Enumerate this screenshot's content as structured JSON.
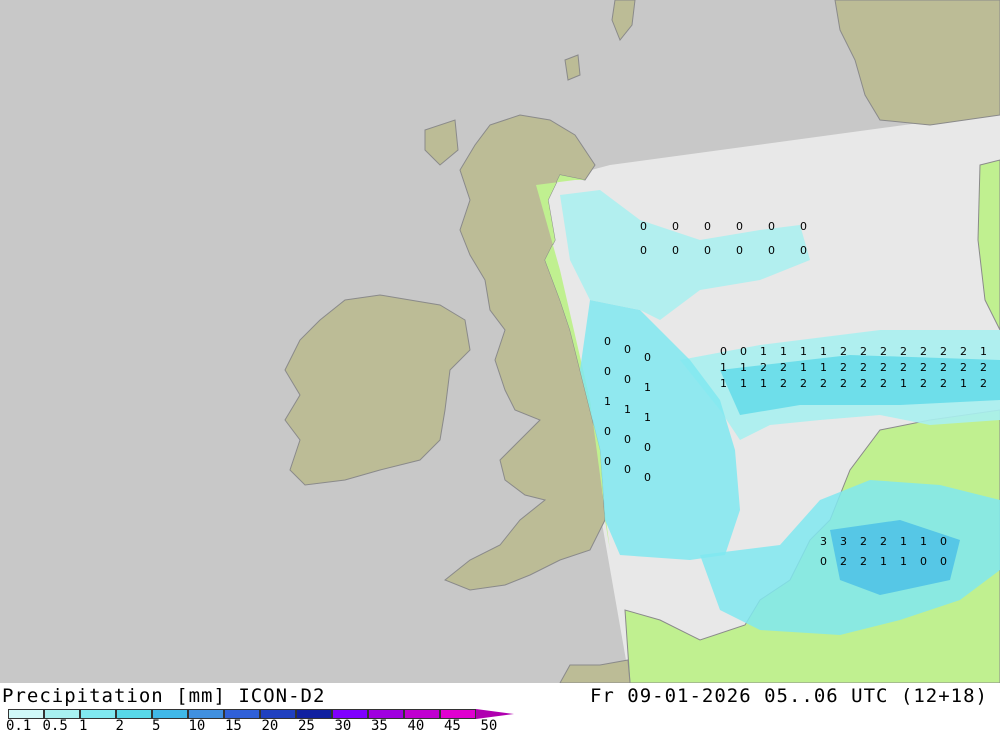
{
  "title": "Precipitation [mm] ICON-D2",
  "datetime": "Fr 09-01-2026 05..06 UTC (12+18)",
  "colors": {
    "background": "#c8c8c8",
    "land": "#bcbc96",
    "coastline": "#8a8a8a",
    "model_domain": "#e8e8e8",
    "green_land_in_domain": "#c0f090"
  },
  "legend": {
    "labels": [
      "0.1",
      "0.5",
      "1",
      "2",
      "5",
      "10",
      "15",
      "20",
      "25",
      "30",
      "35",
      "40",
      "45",
      "50"
    ],
    "colors": [
      "#d0f8f8",
      "#a8f0f0",
      "#80e8f0",
      "#58d8e8",
      "#40b8e8",
      "#4090e0",
      "#3060d8",
      "#2040c0",
      "#1020a0",
      "#8000ff",
      "#a000e0",
      "#c000d0",
      "#e000d0",
      "#b000b0"
    ]
  },
  "precip_values": {
    "north_sea_rows": [
      [
        "0",
        "0",
        "1",
        "1",
        "1",
        "1",
        "2",
        "2",
        "2",
        "2",
        "2",
        "2",
        "2",
        "1",
        "1"
      ],
      [
        "1",
        "1",
        "2",
        "2",
        "1",
        "1",
        "2",
        "2",
        "2",
        "2",
        "2",
        "2",
        "2",
        "2",
        "2"
      ],
      [
        "1",
        "1",
        "1",
        "2",
        "2",
        "2",
        "2",
        "2",
        "2",
        "1",
        "2",
        "2",
        "1",
        "2",
        "2"
      ]
    ],
    "west_column": [
      "0",
      "0",
      "0",
      "0",
      "0",
      "1",
      "1",
      "1",
      "1",
      "0",
      "0",
      "0",
      "0",
      "0",
      "0"
    ],
    "south_cluster": [
      "3",
      "3",
      "2",
      "2",
      "1",
      "1",
      "0",
      "0",
      "2",
      "2",
      "1",
      "1",
      "0",
      "0"
    ],
    "scattered_zeros": [
      "0",
      "0",
      "0",
      "0",
      "0",
      "0",
      "0",
      "0",
      "0",
      "0",
      "0",
      "0"
    ]
  }
}
